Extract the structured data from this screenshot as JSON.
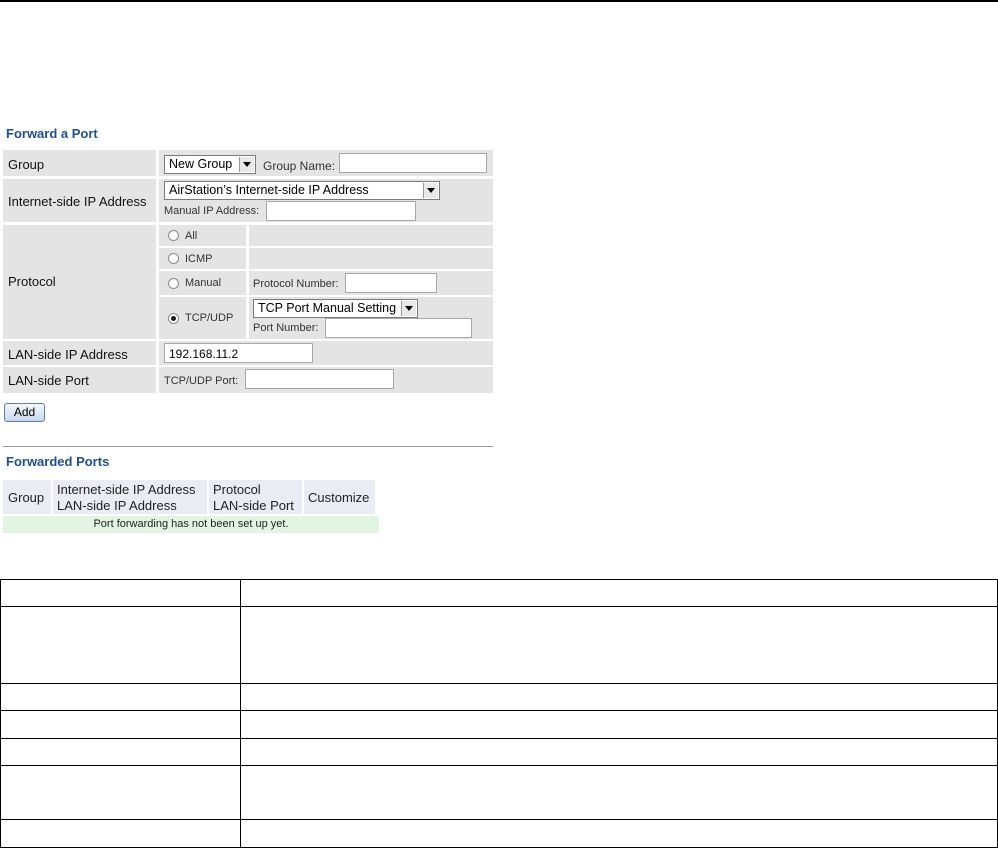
{
  "forward_section": {
    "title": "Forward a Port",
    "group": {
      "label": "Group",
      "select_value": "New Group",
      "name_label": "Group Name:",
      "name_value": ""
    },
    "internet_ip": {
      "label": "Internet-side IP Address",
      "select_value": "AirStation’s Internet-side IP Address",
      "manual_label": "Manual IP Address:",
      "manual_value": ""
    },
    "protocol": {
      "label": "Protocol",
      "options": [
        "All",
        "ICMP",
        "Manual",
        "TCP/UDP"
      ],
      "selected": "TCP/UDP",
      "protocol_number_label": "Protocol Number:",
      "protocol_number_value": "",
      "tcp_select_value": "TCP Port Manual Setting",
      "port_number_label": "Port Number:",
      "port_number_value": ""
    },
    "lan_ip": {
      "label": "LAN-side IP Address",
      "value": "192.168.11.2"
    },
    "lan_port": {
      "label": "LAN-side Port",
      "port_label": "TCP/UDP Port:",
      "port_value": ""
    },
    "add_button": "Add"
  },
  "forwarded_section": {
    "title": "Forwarded Ports",
    "headers": {
      "group": "Group",
      "ip_line1": "Internet-side IP Address",
      "ip_line2": "LAN-side IP Address",
      "proto_line1": "Protocol",
      "proto_line2": "LAN-side Port",
      "customize": "Customize"
    },
    "empty_message": "Port forwarding has not been set up yet."
  }
}
